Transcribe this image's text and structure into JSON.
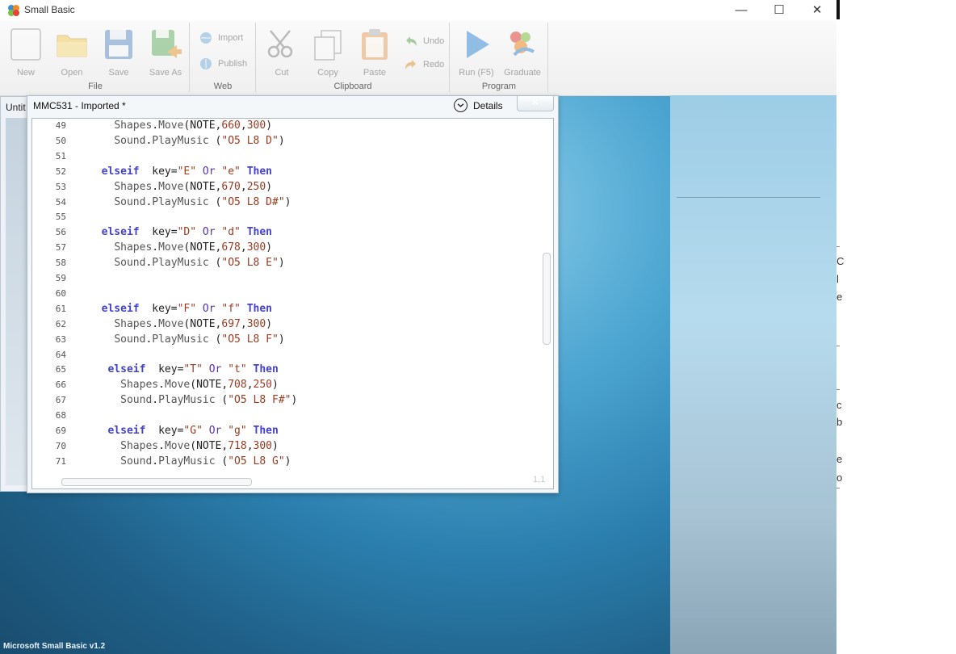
{
  "window": {
    "title": "Small Basic",
    "minimize_glyph": "—",
    "maximize_glyph": "☐",
    "close_glyph": "✕"
  },
  "ribbon": {
    "groups": {
      "file": "File",
      "web": "Web",
      "clipboard": "Clipboard",
      "program": "Program"
    },
    "buttons": {
      "new": "New",
      "open": "Open",
      "save": "Save",
      "save_as": "Save As",
      "import": "Import",
      "publish": "Publish",
      "cut": "Cut",
      "copy": "Copy",
      "paste": "Paste",
      "undo": "Undo",
      "redo": "Redo",
      "run": "Run (F5)",
      "graduate": "Graduate"
    }
  },
  "back_document": {
    "title": "Untit"
  },
  "editor": {
    "title": "MMC531 - Imported *",
    "details_label": "Details",
    "cursor_position": "1,1",
    "lines": [
      {
        "n": "49",
        "tokens": [
          [
            "",
            "    "
          ],
          [
            "fn",
            "Shapes"
          ],
          [
            "",
            "."
          ],
          [
            "fn",
            "Move"
          ],
          [
            "",
            "(NOTE,"
          ],
          [
            "num",
            "660"
          ],
          [
            "",
            ","
          ],
          [
            "num",
            "300"
          ],
          [
            "",
            ")"
          ]
        ]
      },
      {
        "n": "50",
        "tokens": [
          [
            "",
            "    "
          ],
          [
            "fn",
            "Sound"
          ],
          [
            "",
            "."
          ],
          [
            "fn",
            "PlayMusic"
          ],
          [
            "",
            " ("
          ],
          [
            "str",
            "\"O5 L8 D\""
          ],
          [
            "",
            ")"
          ]
        ]
      },
      {
        "n": "51",
        "tokens": []
      },
      {
        "n": "52",
        "tokens": [
          [
            "",
            "  "
          ],
          [
            "kw",
            "elseif"
          ],
          [
            "",
            "  key="
          ],
          [
            "str",
            "\"E\""
          ],
          [
            "",
            " "
          ],
          [
            "op",
            "Or"
          ],
          [
            "",
            " "
          ],
          [
            "str",
            "\"e\""
          ],
          [
            "",
            " "
          ],
          [
            "kw",
            "Then"
          ]
        ]
      },
      {
        "n": "53",
        "tokens": [
          [
            "",
            "    "
          ],
          [
            "fn",
            "Shapes"
          ],
          [
            "",
            "."
          ],
          [
            "fn",
            "Move"
          ],
          [
            "",
            "(NOTE,"
          ],
          [
            "num",
            "670"
          ],
          [
            "",
            ","
          ],
          [
            "num",
            "250"
          ],
          [
            "",
            ")"
          ]
        ]
      },
      {
        "n": "54",
        "tokens": [
          [
            "",
            "    "
          ],
          [
            "fn",
            "Sound"
          ],
          [
            "",
            "."
          ],
          [
            "fn",
            "PlayMusic"
          ],
          [
            "",
            " ("
          ],
          [
            "str",
            "\"O5 L8 D#\""
          ],
          [
            "",
            ")"
          ]
        ]
      },
      {
        "n": "55",
        "tokens": []
      },
      {
        "n": "56",
        "tokens": [
          [
            "",
            "  "
          ],
          [
            "kw",
            "elseif"
          ],
          [
            "",
            "  key="
          ],
          [
            "str",
            "\"D\""
          ],
          [
            "",
            " "
          ],
          [
            "op",
            "Or"
          ],
          [
            "",
            " "
          ],
          [
            "str",
            "\"d\""
          ],
          [
            "",
            " "
          ],
          [
            "kw",
            "Then"
          ]
        ]
      },
      {
        "n": "57",
        "tokens": [
          [
            "",
            "    "
          ],
          [
            "fn",
            "Shapes"
          ],
          [
            "",
            "."
          ],
          [
            "fn",
            "Move"
          ],
          [
            "",
            "(NOTE,"
          ],
          [
            "num",
            "678"
          ],
          [
            "",
            ","
          ],
          [
            "num",
            "300"
          ],
          [
            "",
            ")"
          ]
        ]
      },
      {
        "n": "58",
        "tokens": [
          [
            "",
            "    "
          ],
          [
            "fn",
            "Sound"
          ],
          [
            "",
            "."
          ],
          [
            "fn",
            "PlayMusic"
          ],
          [
            "",
            " ("
          ],
          [
            "str",
            "\"O5 L8 E\""
          ],
          [
            "",
            ")"
          ]
        ]
      },
      {
        "n": "59",
        "tokens": []
      },
      {
        "n": "60",
        "tokens": []
      },
      {
        "n": "61",
        "tokens": [
          [
            "",
            "  "
          ],
          [
            "kw",
            "elseif"
          ],
          [
            "",
            "  key="
          ],
          [
            "str",
            "\"F\""
          ],
          [
            "",
            " "
          ],
          [
            "op",
            "Or"
          ],
          [
            "",
            " "
          ],
          [
            "str",
            "\"f\""
          ],
          [
            "",
            " "
          ],
          [
            "kw",
            "Then"
          ]
        ]
      },
      {
        "n": "62",
        "tokens": [
          [
            "",
            "    "
          ],
          [
            "fn",
            "Shapes"
          ],
          [
            "",
            "."
          ],
          [
            "fn",
            "Move"
          ],
          [
            "",
            "(NOTE,"
          ],
          [
            "num",
            "697"
          ],
          [
            "",
            ","
          ],
          [
            "num",
            "300"
          ],
          [
            "",
            ")"
          ]
        ]
      },
      {
        "n": "63",
        "tokens": [
          [
            "",
            "    "
          ],
          [
            "fn",
            "Sound"
          ],
          [
            "",
            "."
          ],
          [
            "fn",
            "PlayMusic"
          ],
          [
            "",
            " ("
          ],
          [
            "str",
            "\"O5 L8 F\""
          ],
          [
            "",
            ")"
          ]
        ]
      },
      {
        "n": "64",
        "tokens": []
      },
      {
        "n": "65",
        "tokens": [
          [
            "",
            "   "
          ],
          [
            "kw",
            "elseif"
          ],
          [
            "",
            "  key="
          ],
          [
            "str",
            "\"T\""
          ],
          [
            "",
            " "
          ],
          [
            "op",
            "Or"
          ],
          [
            "",
            " "
          ],
          [
            "str",
            "\"t\""
          ],
          [
            "",
            " "
          ],
          [
            "kw",
            "Then"
          ]
        ]
      },
      {
        "n": "66",
        "tokens": [
          [
            "",
            "     "
          ],
          [
            "fn",
            "Shapes"
          ],
          [
            "",
            "."
          ],
          [
            "fn",
            "Move"
          ],
          [
            "",
            "(NOTE,"
          ],
          [
            "num",
            "708"
          ],
          [
            "",
            ","
          ],
          [
            "num",
            "250"
          ],
          [
            "",
            ")"
          ]
        ]
      },
      {
        "n": "67",
        "tokens": [
          [
            "",
            "     "
          ],
          [
            "fn",
            "Sound"
          ],
          [
            "",
            "."
          ],
          [
            "fn",
            "PlayMusic"
          ],
          [
            "",
            " ("
          ],
          [
            "str",
            "\"O5 L8 F#\""
          ],
          [
            "",
            ")"
          ]
        ]
      },
      {
        "n": "68",
        "tokens": []
      },
      {
        "n": "69",
        "tokens": [
          [
            "",
            "   "
          ],
          [
            "kw",
            "elseif"
          ],
          [
            "",
            "  key="
          ],
          [
            "str",
            "\"G\""
          ],
          [
            "",
            " "
          ],
          [
            "op",
            "Or"
          ],
          [
            "",
            " "
          ],
          [
            "str",
            "\"g\""
          ],
          [
            "",
            " "
          ],
          [
            "kw",
            "Then"
          ]
        ]
      },
      {
        "n": "70",
        "tokens": [
          [
            "",
            "     "
          ],
          [
            "fn",
            "Shapes"
          ],
          [
            "",
            "."
          ],
          [
            "fn",
            "Move"
          ],
          [
            "",
            "(NOTE,"
          ],
          [
            "num",
            "718"
          ],
          [
            "",
            ","
          ],
          [
            "num",
            "300"
          ],
          [
            "",
            ")"
          ]
        ]
      },
      {
        "n": "71",
        "tokens": [
          [
            "",
            "     "
          ],
          [
            "fn",
            "Sound"
          ],
          [
            "",
            "."
          ],
          [
            "fn",
            "PlayMusic"
          ],
          [
            "",
            " ("
          ],
          [
            "str",
            "\"O5 L8 G\""
          ],
          [
            "",
            ")"
          ]
        ]
      }
    ]
  },
  "status_bar": {
    "text": "Microsoft Small Basic v1.2"
  },
  "outside_window": {
    "fragments": [
      "C",
      "l",
      "e",
      "c",
      "b",
      "e",
      "o"
    ]
  },
  "colors": {
    "keyword": "#4242c6",
    "string": "#9b3a1f",
    "workspace": "#2b7fae"
  }
}
